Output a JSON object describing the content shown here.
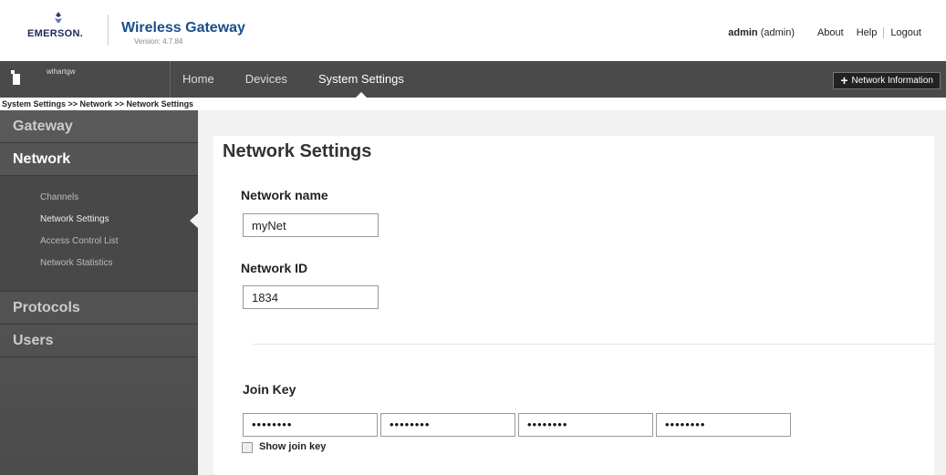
{
  "header": {
    "logo_text": "EMERSON.",
    "app_title": "Wireless Gateway",
    "version": "Version: 4.7.84",
    "user_name": "admin",
    "user_role": "(admin)",
    "links": {
      "about": "About",
      "help": "Help",
      "logout": "Logout"
    }
  },
  "nav": {
    "device_name": "wihartgw",
    "tabs": [
      {
        "label": "Home",
        "active": false
      },
      {
        "label": "Devices",
        "active": false
      },
      {
        "label": "System Settings",
        "active": true
      }
    ],
    "network_info_button": "Network Information",
    "network_info_icon": "plus-icon"
  },
  "breadcrumb": "System Settings >> Network >> Network Settings",
  "sidebar": {
    "sections": [
      {
        "label": "Gateway"
      },
      {
        "label": "Network",
        "active": true
      },
      {
        "label": "Protocols"
      },
      {
        "label": "Users"
      }
    ],
    "network_items": [
      {
        "label": "Channels"
      },
      {
        "label": "Network Settings",
        "active": true
      },
      {
        "label": "Access Control List"
      },
      {
        "label": "Network Statistics"
      }
    ]
  },
  "main": {
    "title": "Network Settings",
    "network_name_label": "Network name",
    "network_name_value": "myNet",
    "network_id_label": "Network ID",
    "network_id_value": "1834",
    "join_key_label": "Join Key",
    "join_key_values": [
      "••••••••",
      "••••••••",
      "••••••••",
      "••••••••"
    ],
    "show_join_key_label": "Show join key",
    "show_join_key_checked": false
  },
  "colors": {
    "brand_title": "#1a4d8c",
    "nav_bg": "#4a4a4a",
    "sidebar_bg": "#4c4c4c"
  }
}
